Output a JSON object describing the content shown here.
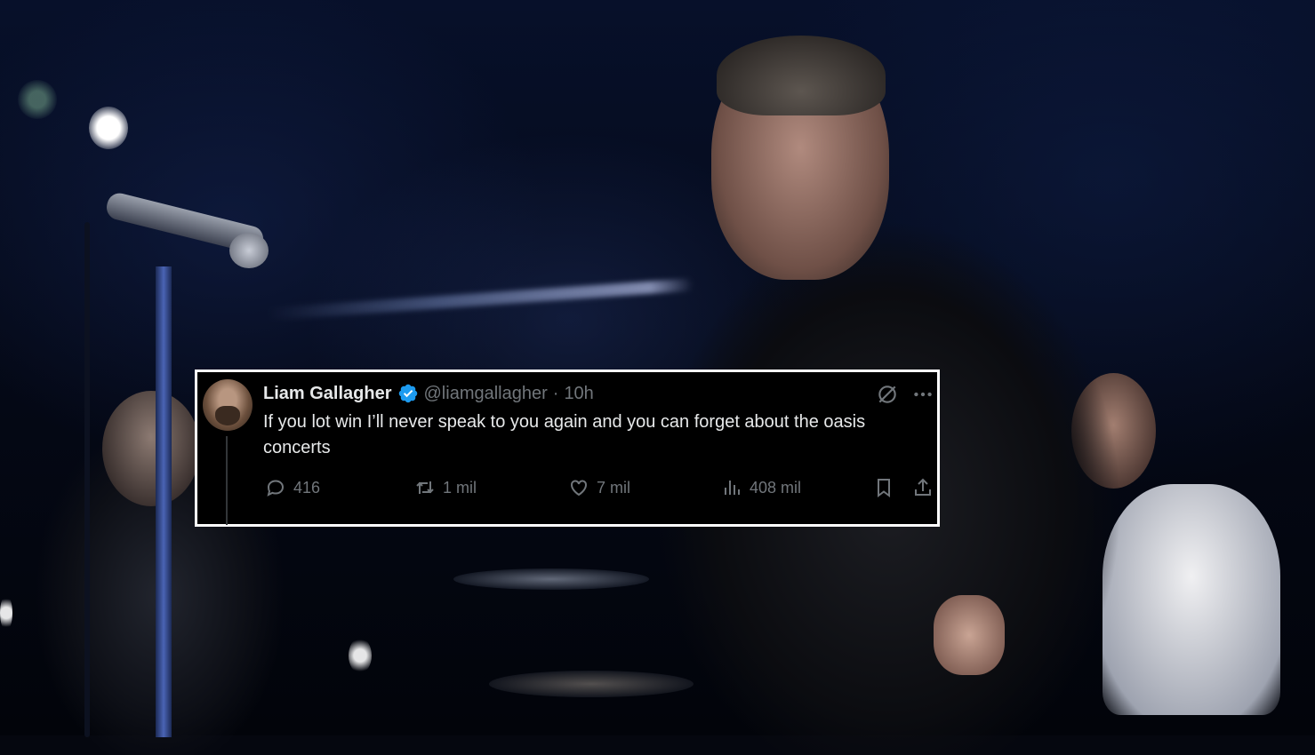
{
  "tweet": {
    "display_name": "Liam Gallagher",
    "handle": "@liamgallagher",
    "separator": "·",
    "time": "10h",
    "text": "If you lot win I’ll never speak to you again and you can forget about the oasis concerts",
    "stats": {
      "replies": "416",
      "retweets": "1 mil",
      "likes": "7 mil",
      "views": "408 mil"
    }
  },
  "colors": {
    "card_background": "#000000",
    "card_border": "#ffffff",
    "primary_text": "#e7e9ea",
    "secondary_text": "#71767b",
    "verified_badge": "#1d9bf0"
  },
  "icons": [
    "verified-badge-icon",
    "grok-icon",
    "more-icon",
    "reply-icon",
    "retweet-icon",
    "like-icon",
    "views-icon",
    "bookmark-icon",
    "share-icon"
  ]
}
